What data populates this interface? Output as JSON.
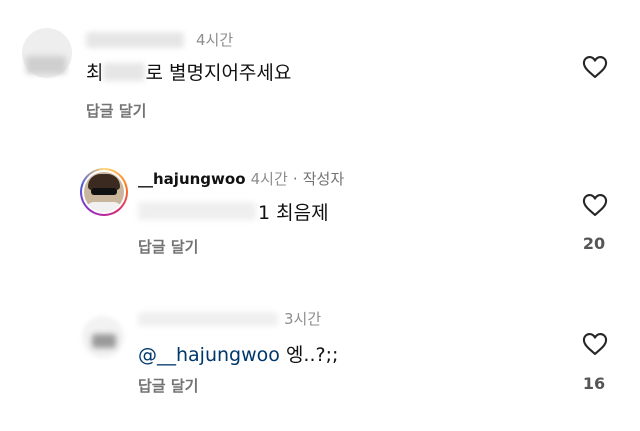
{
  "comments": [
    {
      "time": "4시간",
      "text_prefix": "최",
      "text_suffix": "로 별명지어주세요",
      "reply_label": "답글 달기",
      "likes": ""
    },
    {
      "username": "__hajungwoo",
      "time": "4시간",
      "separator": "·",
      "author_badge": "작성자",
      "text_end": "1 최음제",
      "reply_label": "답글 달기",
      "likes": "20"
    },
    {
      "time": "3시간",
      "mention": "@__hajungwoo",
      "text": "엥..?;;",
      "reply_label": "답글 달기",
      "likes": "16"
    }
  ],
  "icons": {
    "like": "heart-outline-icon"
  }
}
